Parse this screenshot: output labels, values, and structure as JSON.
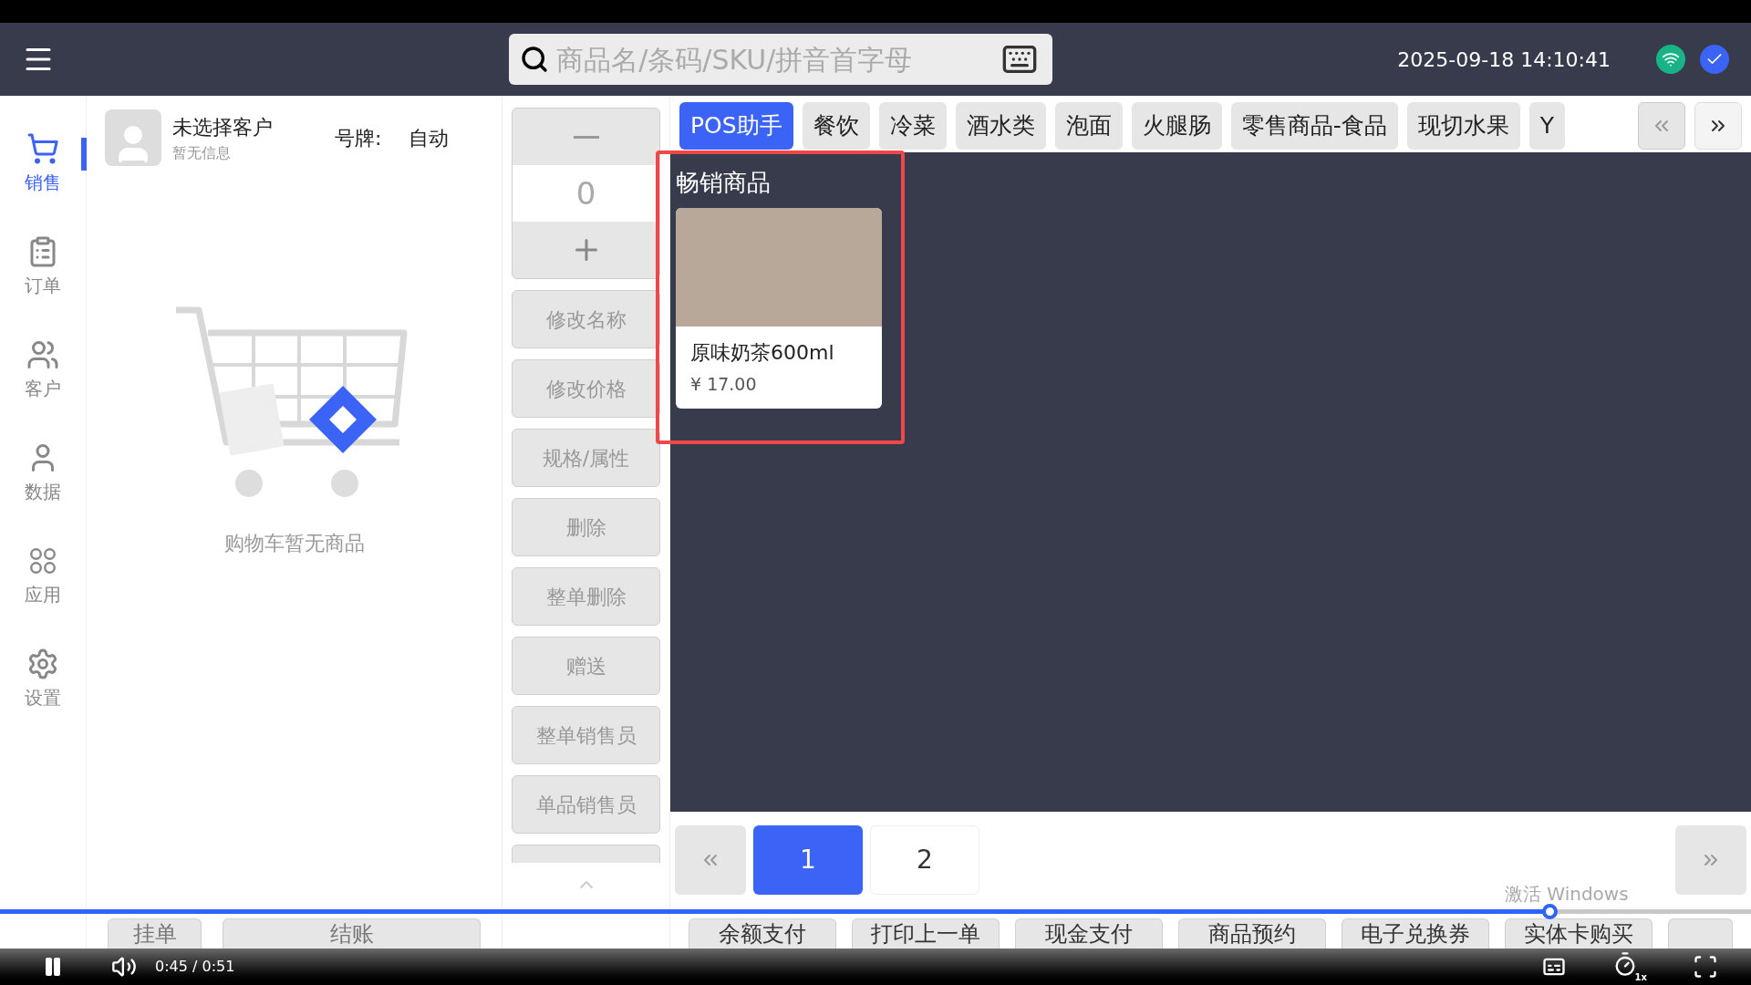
{
  "header": {
    "search": {
      "placeholder": "商品名/条码/SKU/拼音首字母"
    },
    "datetime": "2025-09-18 14:10:41"
  },
  "nav": [
    {
      "label": "销售",
      "selected": true,
      "kind": "cart"
    },
    {
      "label": "订单",
      "selected": false,
      "kind": "orders"
    },
    {
      "label": "客户",
      "selected": false,
      "kind": "customers"
    },
    {
      "label": "数据",
      "selected": false,
      "kind": "data"
    },
    {
      "label": "应用",
      "selected": false,
      "kind": "apps"
    },
    {
      "label": "设置",
      "selected": false,
      "kind": "settings"
    }
  ],
  "customer": {
    "name": "未选择客户",
    "info": "暂无信息",
    "plate_label": "号牌:",
    "plate_value": "自动"
  },
  "cart": {
    "empty_text": "购物车暂无商品"
  },
  "quantity": {
    "value": "0"
  },
  "actions": [
    "修改名称",
    "修改价格",
    "规格/属性",
    "删除",
    "整单删除",
    "赠送",
    "整单销售员",
    "单品销售员"
  ],
  "checkout_buttons": [
    "挂单",
    "结账"
  ],
  "categories": [
    {
      "label": "POS助手",
      "selected": true
    },
    {
      "label": "餐饮",
      "selected": false
    },
    {
      "label": "冷菜",
      "selected": false
    },
    {
      "label": "酒水类",
      "selected": false
    },
    {
      "label": "泡面",
      "selected": false
    },
    {
      "label": "火腿肠",
      "selected": false
    },
    {
      "label": "零售商品-食品",
      "selected": false
    },
    {
      "label": "现切水果",
      "selected": false
    },
    {
      "label": "Y",
      "selected": false
    }
  ],
  "section": {
    "title": "畅销商品",
    "products": [
      {
        "name": "原味奶茶600ml",
        "price": "¥ 17.00"
      }
    ]
  },
  "pagination": {
    "pages": [
      {
        "label": "1",
        "selected": true
      },
      {
        "label": "2",
        "selected": false
      }
    ]
  },
  "payment_buttons": [
    "余额支付",
    "打印上一单",
    "现金支付",
    "商品预约",
    "电子兑换券",
    "实体卡购买"
  ],
  "video_player": {
    "time": "0:45 / 0:51",
    "speed": "1x",
    "level": 0.885
  },
  "system_notice": "激活 Windows"
}
